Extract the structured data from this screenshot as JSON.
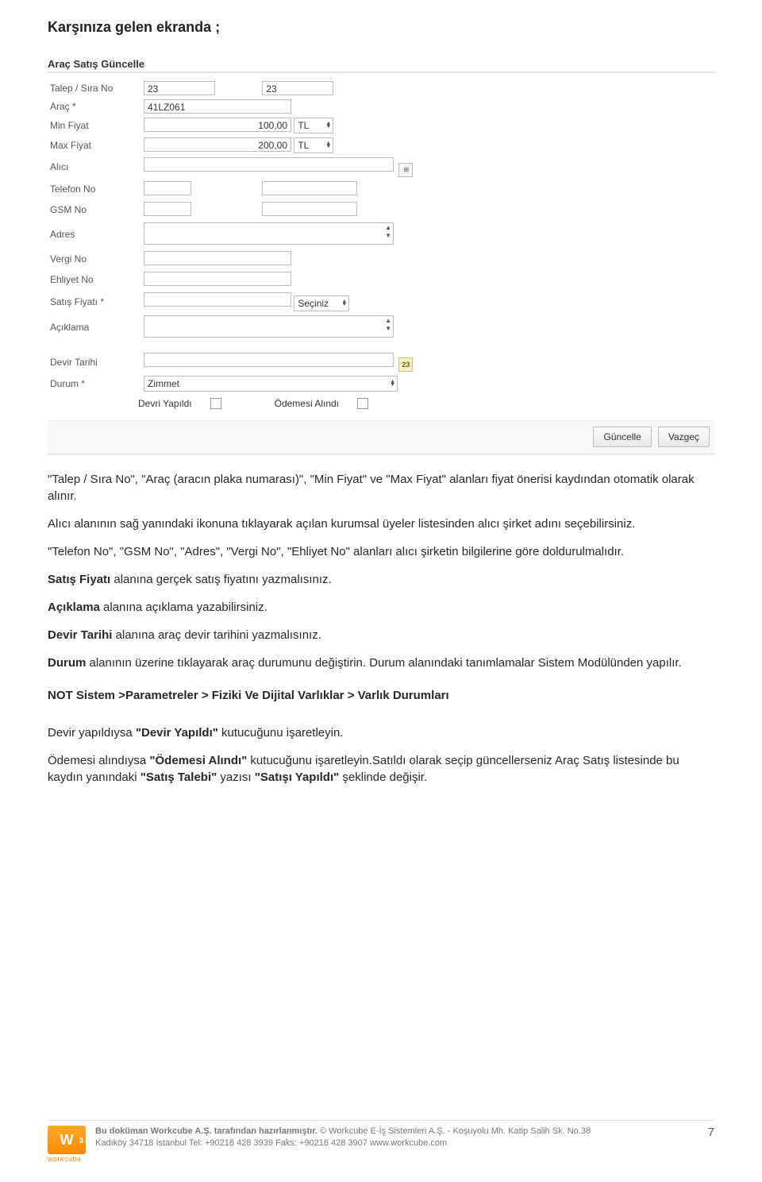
{
  "doc": {
    "heading": "Karşınıza gelen ekranda ;",
    "page_number": "7"
  },
  "form": {
    "title": "Araç Satış Güncelle",
    "labels": {
      "talep_sira": "Talep / Sıra No",
      "arac": "Araç *",
      "min_fiyat": "Min Fiyat",
      "max_fiyat": "Max Fiyat",
      "alici": "Alıcı",
      "telefon": "Telefon No",
      "gsm": "GSM No",
      "adres": "Adres",
      "vergi": "Vergi No",
      "ehliyet": "Ehliyet No",
      "satis_fiyat": "Satış Fiyatı *",
      "aciklama": "Açıklama",
      "devir_tarihi": "Devir Tarihi",
      "durum": "Durum *"
    },
    "values": {
      "talep_no": "23",
      "sira_no": "23",
      "arac": "41LZ061",
      "min_fiyat": "100,00",
      "max_fiyat": "200,00",
      "min_cur": "TL",
      "max_cur": "TL",
      "alici": "",
      "telefon_area": "",
      "telefon_num": "",
      "gsm_area": "",
      "gsm_num": "",
      "vergi": "",
      "ehliyet": "",
      "satis_fiyat": "",
      "satis_cur": "Seçiniz",
      "devir_tarihi": "",
      "durum": "Zimmet"
    },
    "checkboxes": {
      "devri_yapildi": "Devri Yapıldı",
      "odemesi_alindi": "Ödemesi Alındı"
    },
    "buttons": {
      "guncelle": "Güncelle",
      "vazgec": "Vazgeç"
    },
    "cal_badge": "23"
  },
  "body": {
    "p1_a": "\"Talep / Sıra No\", \"Araç (aracın plaka numarası)\", \"Min Fiyat\" ve \"Max Fiyat\" alanları fiyat önerisi kaydından otomatik olarak alınır.",
    "p2": "Alıcı alanının sağ yanındaki ikonuna tıklayarak açılan kurumsal üyeler listesinden alıcı şirket adını seçebilirsiniz.",
    "p3": "\"Telefon No\", \"GSM No\", \"Adres\", \"Vergi No\", \"Ehliyet No\" alanları alıcı şirketin bilgilerine göre doldurulmalıdır.",
    "p4_b": "Satış Fiyatı",
    "p4_t": " alanına gerçek satış fiyatını yazmalısınız.",
    "p5_b": "Açıklama",
    "p5_t": " alanına açıklama yazabilirsiniz.",
    "p6_b": "Devir Tarihi",
    "p6_t": " alanına araç devir tarihini yazmalısınız.",
    "p7_b": "Durum",
    "p7_t": " alanının üzerine tıklayarak araç durumunu değiştirin. Durum alanındaki tanımlamalar Sistem Modülünden yapılır.",
    "p8": "NOT Sistem >Parametreler > Fiziki Ve Dijital Varlıklar > Varlık Durumları",
    "p9_a": "Devir yapıldıysa ",
    "p9_b": "\"Devir Yapıldı\"",
    "p9_c": " kutucuğunu işaretleyin.",
    "p10_a": "Ödemesi alındıysa ",
    "p10_b": "\"Ödemesi Alındı\"",
    "p10_c": " kutucuğunu işaretleyin.Satıldı olarak seçip güncellerseniz Araç Satış listesinde bu kaydın yanındaki ",
    "p10_d": "\"Satış Talebi\"",
    "p10_e": " yazısı ",
    "p10_f": "\"Satışı Yapıldı\"",
    "p10_g": " şeklinde değişir."
  },
  "footer": {
    "logo_text": "W",
    "logo_sup": "3",
    "logo_caption": "workcube",
    "line1_a": "Bu doküman Workcube A.Ş. tarafından hazırlanmıştır. ",
    "line1_b": "© Workcube E-İş Sistemleri A.Ş. - Koşuyolu Mh. Katip Salih Sk. No.38",
    "line2": "Kadıköy 34718 İstanbul Tel: +90216 428 3939 Faks: +90216 428 3907 www.workcube.com"
  }
}
